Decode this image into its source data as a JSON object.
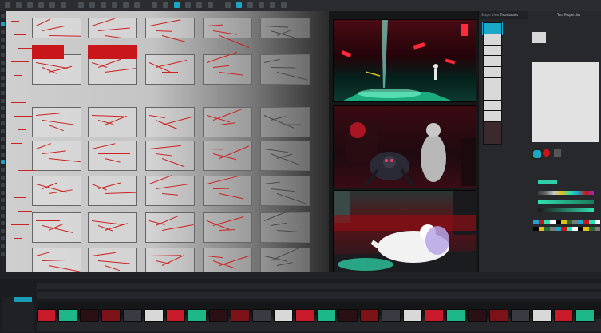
{
  "topbar": {
    "buttons": [
      "menu-icon",
      "undo-icon",
      "redo-icon",
      "cut-icon",
      "copy-icon",
      "paste-icon",
      "brush-icon",
      "pencil-icon",
      "eraser-icon",
      "select-icon",
      "transform-icon",
      "zoom-icon",
      "hand-icon",
      "rotate-icon",
      "play-icon",
      "stop-icon",
      "record-icon",
      "camera-icon",
      "grid-icon",
      "onion-icon",
      "sound-icon",
      "settings-icon",
      "layout-icon",
      "share-icon"
    ]
  },
  "left_tools": {
    "tools": [
      "pointer-icon",
      "brush-icon",
      "pencil-icon",
      "eraser-icon",
      "fill-icon",
      "shape-icon",
      "text-icon",
      "eyedropper-icon",
      "hand-icon",
      "zoom-icon",
      "rotate-icon",
      "camera-icon",
      "transform-icon",
      "select-icon",
      "lasso-icon",
      "cut-icon",
      "ruler-icon",
      "pen-icon",
      "line-icon",
      "ellipse-icon",
      "rectangle-icon",
      "polyline-icon",
      "contour-icon",
      "stamp-icon",
      "morph-icon",
      "bone-icon",
      "deform-icon",
      "sound-icon",
      "lipsync-icon",
      "pivot-icon",
      "repos-icon",
      "more-icon"
    ]
  },
  "layers_panel": {
    "tabs": [
      "Stage View",
      "Thumbnails"
    ],
    "items": [
      "",
      "",
      "",
      "",
      "",
      "",
      "",
      "",
      "",
      "",
      ""
    ]
  },
  "tool_panel": {
    "tabs": [
      "Tool Properties"
    ],
    "colors": [
      "#1aa7c8",
      "#c8161b",
      "#2fe0b0",
      "#ffffff",
      "#000000",
      "#e0c020",
      "#2a6a3a",
      "#7a7a7a"
    ]
  },
  "accent": "#1aa7c8",
  "timeline": {
    "labels": [
      "",
      "",
      "",
      ""
    ]
  }
}
